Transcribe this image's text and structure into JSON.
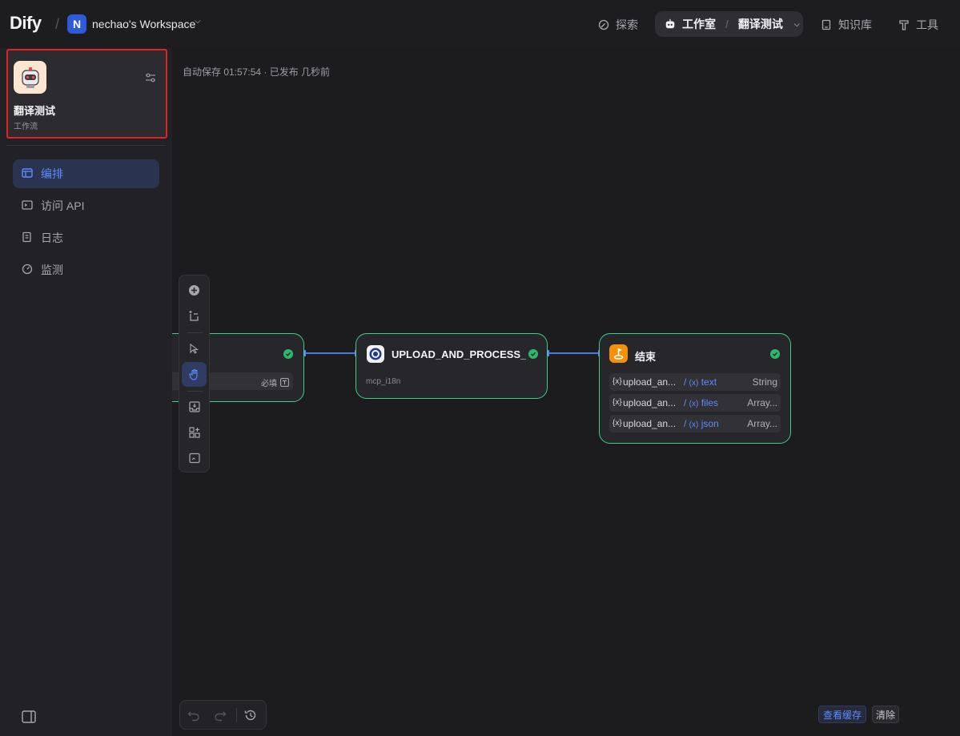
{
  "header": {
    "logo": "Dify",
    "workspace_initial": "N",
    "workspace_name": "nechao's Workspace",
    "nav": {
      "explore": "探索",
      "studio": "工作室",
      "current_app": "翻译测试",
      "knowledge": "知识库",
      "tools": "工具"
    }
  },
  "sidebar": {
    "app": {
      "name": "翻译测试",
      "type": "工作流"
    },
    "menu": [
      {
        "label": "编排",
        "active": true,
        "icon": "layout-icon"
      },
      {
        "label": "访问 API",
        "active": false,
        "icon": "terminal-icon"
      },
      {
        "label": "日志",
        "active": false,
        "icon": "document-icon"
      },
      {
        "label": "监测",
        "active": false,
        "icon": "gauge-icon"
      }
    ]
  },
  "canvas": {
    "status": "自动保存 01:57:54 · 已发布 几秒前",
    "nodes": {
      "start": {
        "required_label": "必填"
      },
      "tool": {
        "title": "UPLOAD_AND_PROCESS_I",
        "subtitle": "mcp_i18n"
      },
      "end": {
        "title": "结束",
        "outputs": [
          {
            "var": "upload_an...",
            "ref": "text",
            "type": "String"
          },
          {
            "var": "upload_an...",
            "ref": "files",
            "type": "Array..."
          },
          {
            "var": "upload_an...",
            "ref": "json",
            "type": "Array..."
          }
        ]
      }
    },
    "footer": {
      "view_cache": "查看缓存",
      "clear": "清除"
    }
  },
  "colors": {
    "accent": "#5b8cff",
    "node_border": "#3ccf86",
    "highlight_box": "#e0231f",
    "workspace_badge": "#2f5bd8",
    "end_node_icon": "#f79009"
  }
}
